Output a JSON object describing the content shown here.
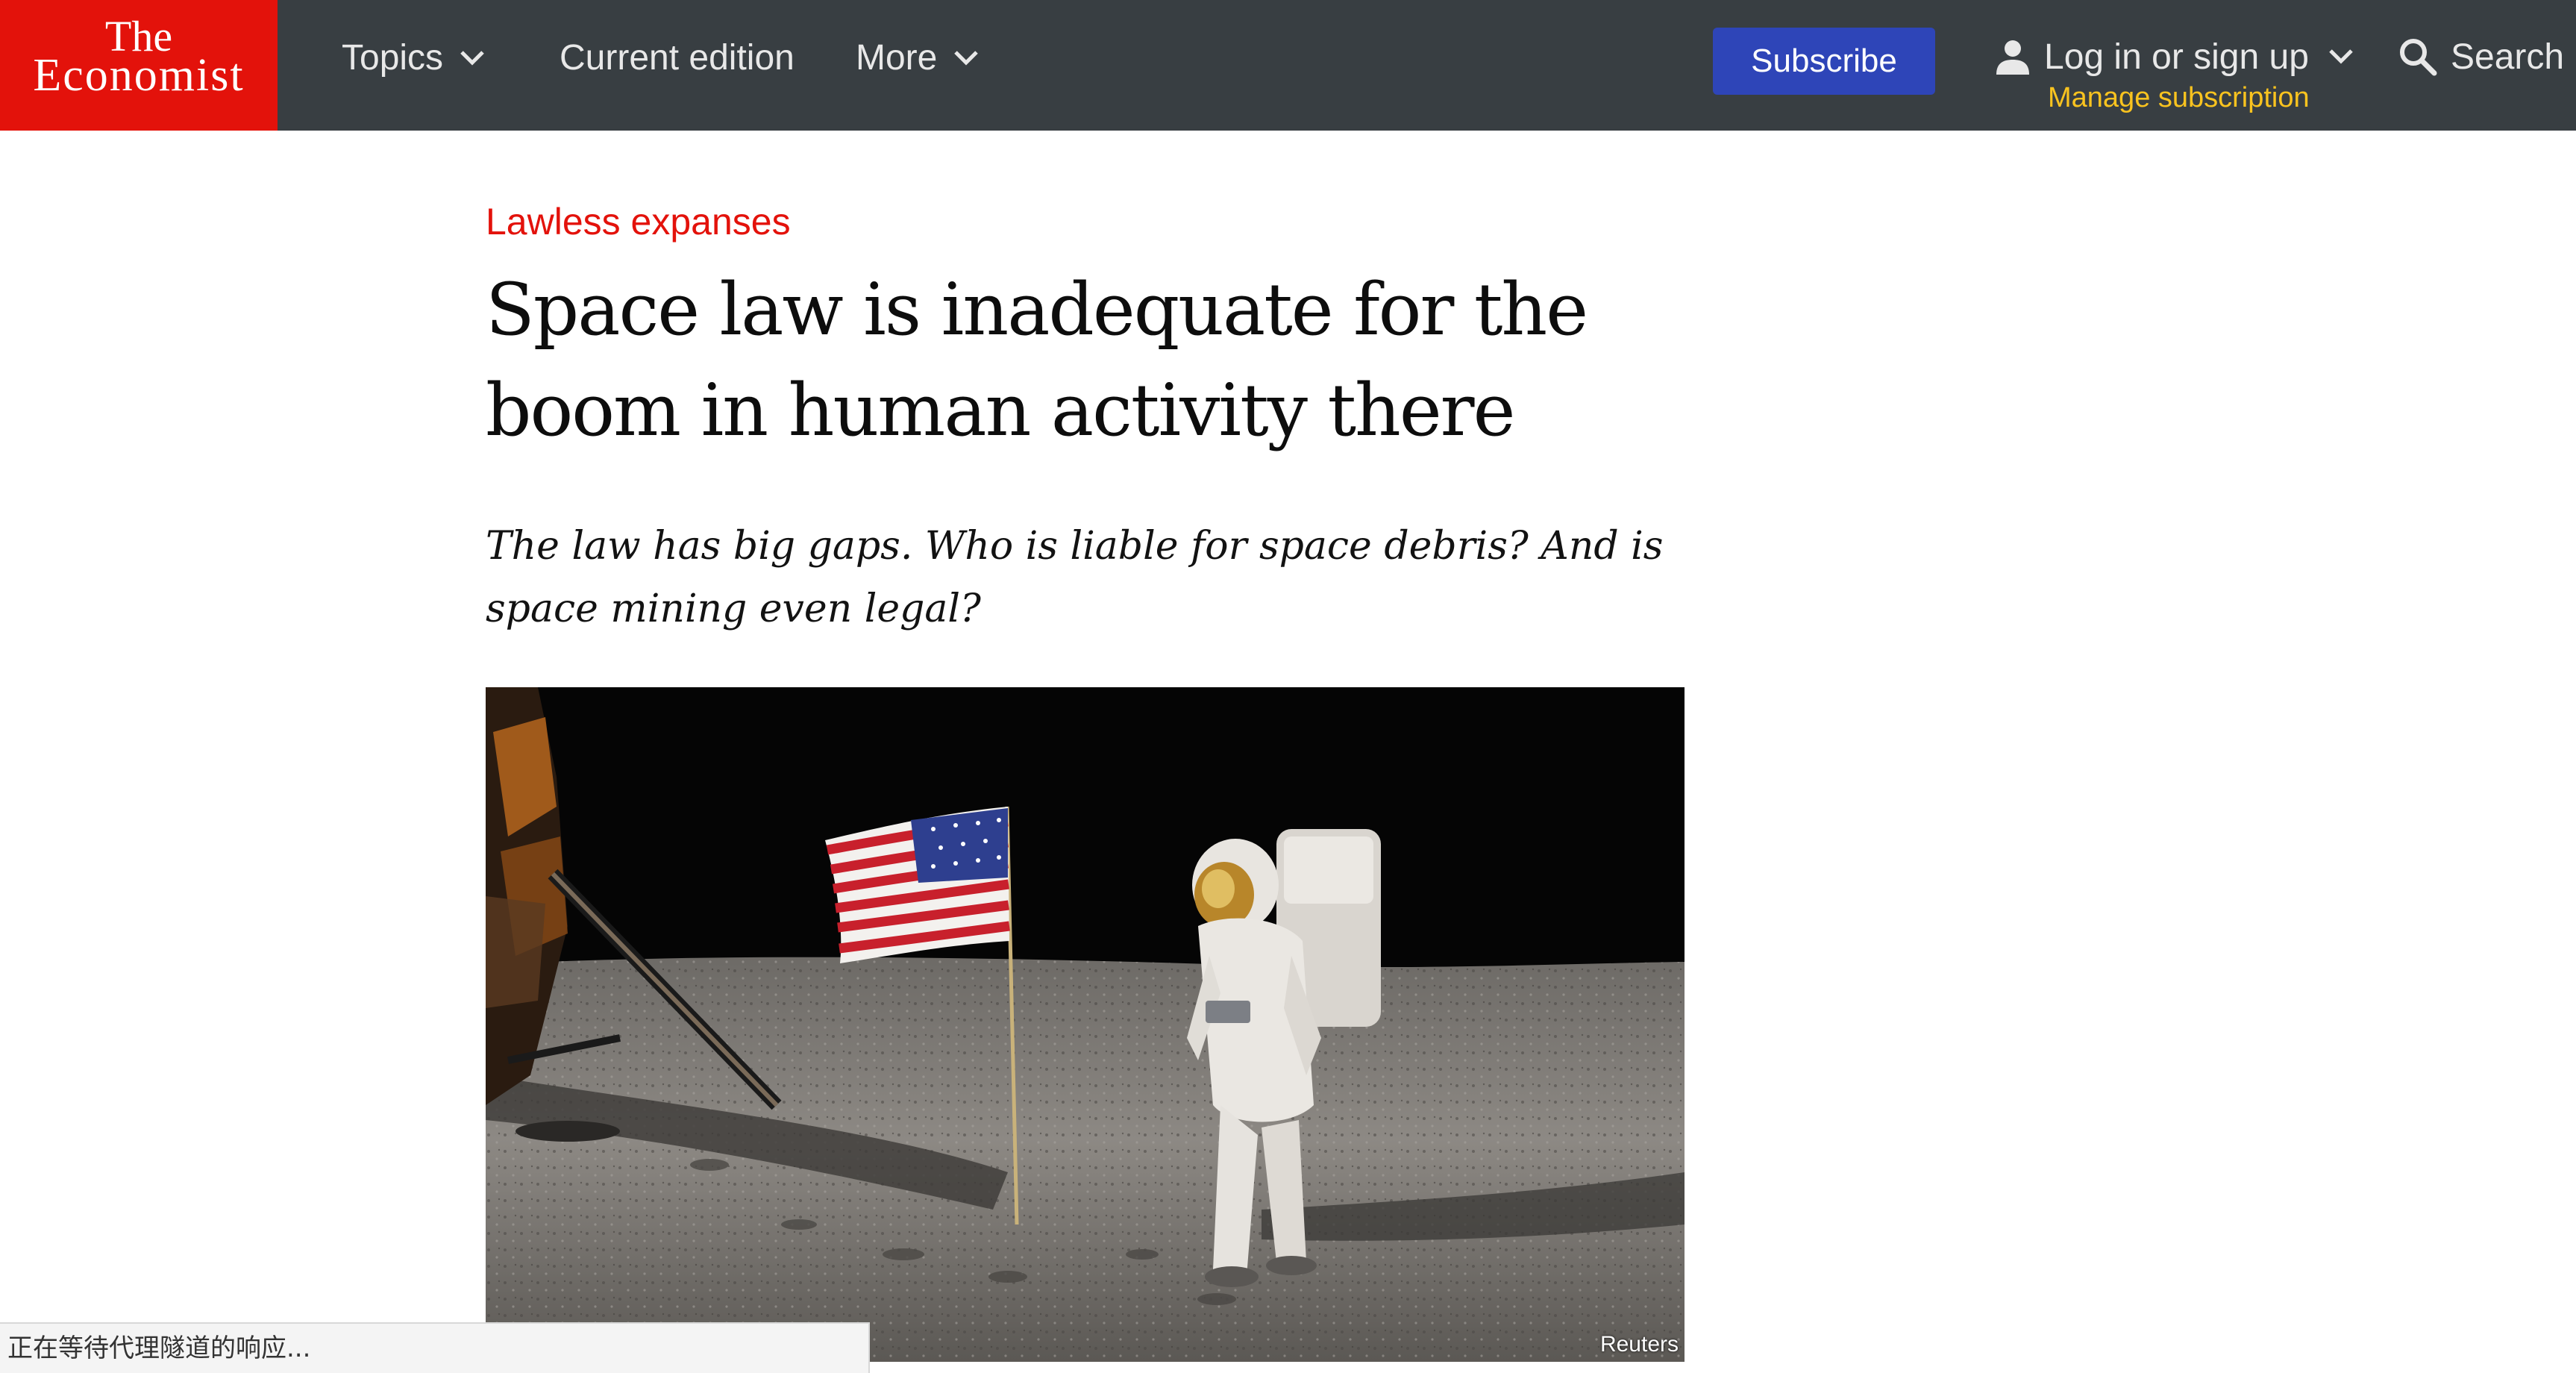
{
  "brand": {
    "line1": "The",
    "line2": "Economist",
    "color": "#e3120b"
  },
  "nav": {
    "topics": "Topics",
    "current_edition": "Current edition",
    "more": "More",
    "subscribe": "Subscribe",
    "login": "Log in or sign up",
    "manage": "Manage subscription",
    "search": "Search"
  },
  "article": {
    "rubric": "Lawless expanses",
    "headline": "Space law is inadequate for the boom in human activity there",
    "standfirst": "The law has big gaps. Who is liable for space debris? And is space mining even legal?",
    "image_credit": "Reuters"
  },
  "status_bar": {
    "text": "正在等待代理隧道的响应..."
  },
  "colors": {
    "topbar": "#383e42",
    "subscribe": "#2e45b8",
    "manage": "#f9c31f",
    "rubric": "#e3120b"
  }
}
